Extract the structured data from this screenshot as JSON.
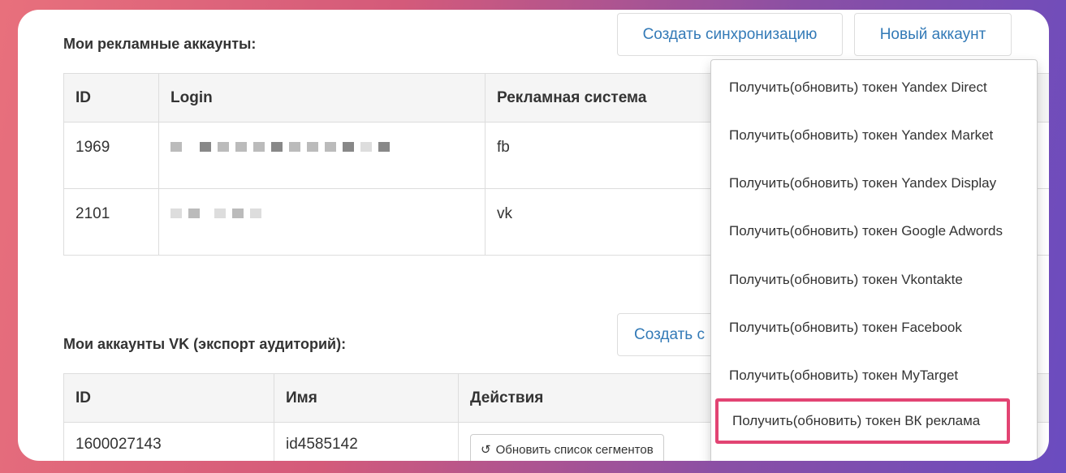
{
  "section1": {
    "title": "Мои рекламные аккаунты:",
    "buttons": {
      "sync": "Создать синхронизацию",
      "new_account": "Новый аккаунт"
    },
    "headers": [
      "ID",
      "Login",
      "Рекламная система"
    ],
    "rows": [
      {
        "id": "1969",
        "system": "fb"
      },
      {
        "id": "2101",
        "system": "vk"
      }
    ]
  },
  "section2": {
    "title": "Мои аккаунты VK (экспорт аудиторий):",
    "buttons": {
      "create": "Создать с"
    },
    "headers": [
      "ID",
      "Имя",
      "Действия"
    ],
    "rows": [
      {
        "id": "1600027143",
        "name": "id4585142",
        "action": "Обновить список сегментов"
      }
    ]
  },
  "dropdown": {
    "items": [
      "Получить(обновить) токен Yandex Direct",
      "Получить(обновить) токен Yandex Market",
      "Получить(обновить) токен Yandex Display",
      "Получить(обновить) токен Google Adwords",
      "Получить(обновить) токен Vkontakte",
      "Получить(обновить) токен Facebook",
      "Получить(обновить) токен MyTarget",
      "Получить(обновить) токен ВК реклама"
    ],
    "highlight_color": "#e24473"
  },
  "colors": {
    "link": "#337ab7",
    "header_bg": "#f5f5f5"
  }
}
